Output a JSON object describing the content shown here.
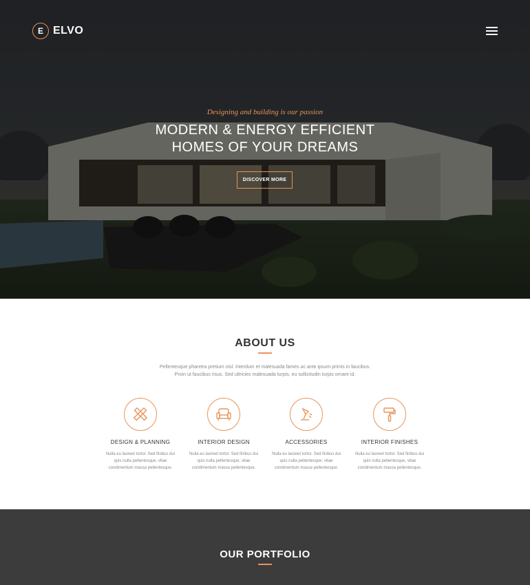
{
  "brand": {
    "logo_letter": "E",
    "name": "ELVO",
    "accent": "#e8935a"
  },
  "nav": {
    "menu_icon": "hamburger-icon"
  },
  "hero": {
    "tagline": "Designing and building is our passion",
    "headline_line1": "MODERN & ENERGY EFFICIENT",
    "headline_line2": "HOMES OF YOUR DREAMS",
    "cta_label": "DISCOVER MORE"
  },
  "about": {
    "title": "ABOUT US",
    "intro": "Pellentesque pharetra pretium nisl. Interdum et malesuada fames ac ante ipsum primis in faucibus. Proin ut faucibus risus. Sed ultricies malesuada turpis, eu sollicitudin turpis ornare id.",
    "features": [
      {
        "icon": "pencil-ruler-icon",
        "title": "DESIGN & PLANNING",
        "text": "Nulla eu laoreet tortor. Sed finibus dui quis nulla pellentesque, vitae condimentum massa pellentesque."
      },
      {
        "icon": "armchair-icon",
        "title": "INTERIOR DESIGN",
        "text": "Nulla eu laoreet tortor. Sed finibus dui quis nulla pellentesque, vitae condimentum massa pellentesque."
      },
      {
        "icon": "desk-lamp-icon",
        "title": "ACCESSORIES",
        "text": "Nulla eu laoreet tortor. Sed finibus dui quis nulla pellentesque, vitae condimentum massa pellentesque."
      },
      {
        "icon": "paint-roller-icon",
        "title": "INTERIOR FINISHES",
        "text": "Nulla eu laoreet tortor. Sed finibus dui quis nulla pellentesque, vitae condimentum massa pellentesque."
      }
    ]
  },
  "portfolio": {
    "title": "OUR PORTFOLIO"
  }
}
